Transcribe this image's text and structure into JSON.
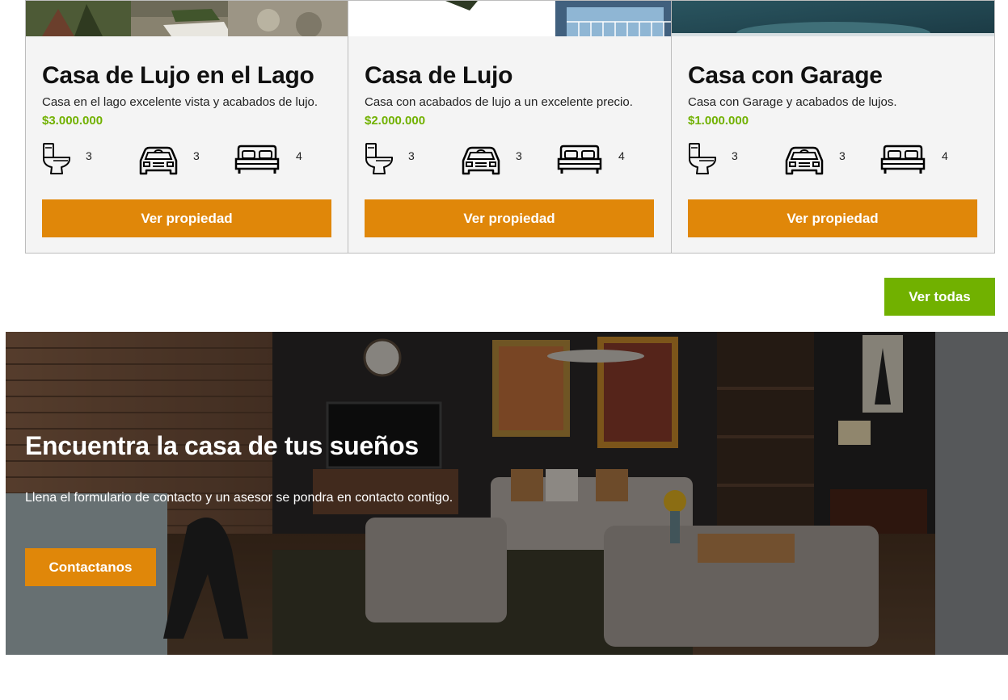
{
  "properties": [
    {
      "title": "Casa de Lujo en el Lago",
      "description": "Casa en el lago excelente vista y acabados de lujo.",
      "price": "$3.000.000",
      "wc": "3",
      "parking": "3",
      "bedrooms": "4",
      "button_label": "Ver propiedad"
    },
    {
      "title": "Casa de Lujo",
      "description": "Casa con acabados de lujo a un excelente precio.",
      "price": "$2.000.000",
      "wc": "3",
      "parking": "3",
      "bedrooms": "4",
      "button_label": "Ver propiedad"
    },
    {
      "title": "Casa con Garage",
      "description": "Casa con Garage y acabados de lujos.",
      "price": "$1.000.000",
      "wc": "3",
      "parking": "3",
      "bedrooms": "4",
      "button_label": "Ver propiedad"
    }
  ],
  "view_all_label": "Ver todas",
  "contact_section": {
    "title": "Encuentra la casa de tus sueños",
    "text": "Llena el formulario de contacto y un asesor se pondra en contacto contigo.",
    "button_label": "Contactanos"
  },
  "icons": {
    "wc": "toilet-icon",
    "parking": "car-icon",
    "bedrooms": "bed-icon"
  },
  "colors": {
    "accent_orange": "#e08709",
    "accent_green": "#71b100",
    "card_background": "#f4f4f4"
  }
}
